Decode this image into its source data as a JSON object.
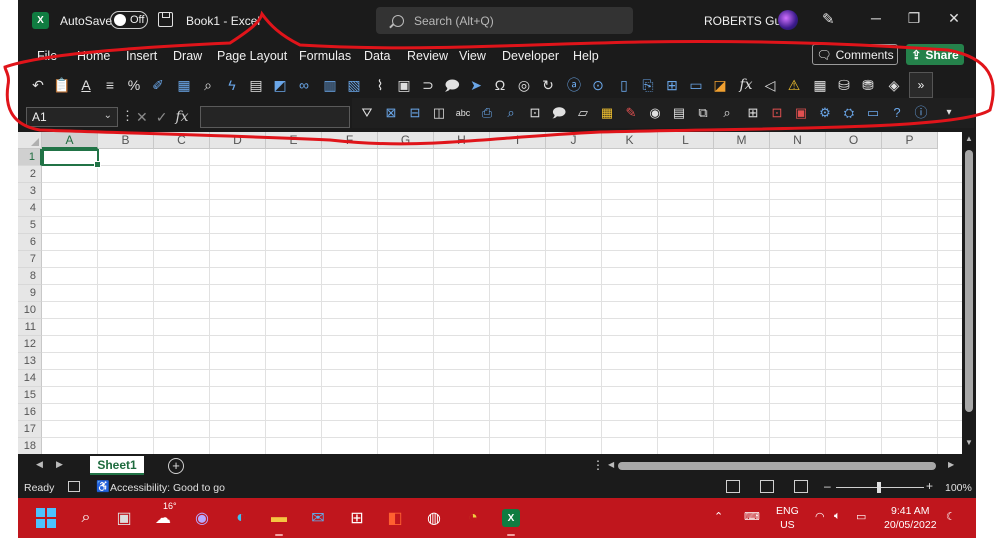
{
  "titlebar": {
    "autosave_label": "AutoSave",
    "autosave_state": "Off",
    "document_title": "Book1  -  Excel",
    "search_placeholder": "Search (Alt+Q)",
    "user_name": "ROBERTS Guy",
    "window_buttons": [
      "minimize-icon",
      "restore-icon",
      "close-icon"
    ]
  },
  "menu": {
    "tabs": [
      "File",
      "Home",
      "Insert",
      "Draw",
      "Page Layout",
      "Formulas",
      "Data",
      "Review",
      "View",
      "Developer",
      "Help"
    ],
    "comments_label": "Comments",
    "share_label": "Share"
  },
  "toolbar_row1": {
    "icons": [
      "undo-icon",
      "paste-icon",
      "font-color-icon",
      "align-icon",
      "percent-icon",
      "format-painter-icon",
      "table-icon",
      "find-icon",
      "flash-fill-icon",
      "grid-icon",
      "shapes-icon",
      "link-icon",
      "chart-icon",
      "pivot-icon",
      "sparkline-icon",
      "form-icon",
      "hyperlink-icon",
      "comment-icon",
      "send-icon",
      "symbol-icon",
      "ink-icon",
      "ink-replay-icon",
      "replace-icon",
      "play-icon",
      "text-box-icon",
      "page-break-icon",
      "margins-icon",
      "print-area-icon",
      "arrange-icon",
      "function-icon",
      "trace-icon",
      "error-check-icon",
      "calculator-icon",
      "database-icon",
      "database-refresh-icon",
      "convert-icon"
    ],
    "more_label": "»"
  },
  "formula_bar": {
    "name_box_value": "A1",
    "formula_value": ""
  },
  "toolbar_row2": {
    "icons": [
      "filter-icon",
      "clear-filter-icon",
      "text-to-columns-icon",
      "split-icon",
      "spelling-icon",
      "research-icon",
      "smart-lookup-icon",
      "workbook-stats-icon",
      "new-comment-icon",
      "note-icon",
      "protect-sheet-icon",
      "ink-edit-icon",
      "show-icon",
      "document-icon",
      "compare-icon",
      "zoom-icon",
      "new-window-icon",
      "record-macro-icon",
      "macros-icon",
      "properties-icon",
      "design-mode-icon",
      "dialog-icon",
      "help-icon",
      "help-circle-icon",
      "overflow-icon"
    ]
  },
  "grid": {
    "columns": [
      "A",
      "B",
      "C",
      "D",
      "E",
      "F",
      "G",
      "H",
      "I",
      "J",
      "K",
      "L",
      "M",
      "N",
      "O",
      "P"
    ],
    "rows": [
      "1",
      "2",
      "3",
      "4",
      "5",
      "6",
      "7",
      "8",
      "9",
      "10",
      "11",
      "12",
      "13",
      "14",
      "15",
      "16",
      "17",
      "18"
    ],
    "active_cell": "A1"
  },
  "sheets": {
    "tabs": [
      "Sheet1"
    ],
    "add_label": "+"
  },
  "statusbar": {
    "ready": "Ready",
    "accessibility": "Accessibility: Good to go",
    "zoom": "100%"
  },
  "taskbar": {
    "weather": "16°",
    "language_line1": "ENG",
    "language_line2": "US",
    "time": "9:41 AM",
    "date": "20/05/2022",
    "apps": [
      "windows-start-icon",
      "search-icon",
      "task-view-icon",
      "weather-icon",
      "teams-chat-icon",
      "edge-icon",
      "file-explorer-icon",
      "mail-icon",
      "store-icon",
      "office-icon",
      "steam-icon",
      "chrome-icon",
      "excel-icon"
    ]
  },
  "colors": {
    "annotation": "#e0141a",
    "excel_green": "#217346",
    "taskbar": "#c0161d"
  }
}
